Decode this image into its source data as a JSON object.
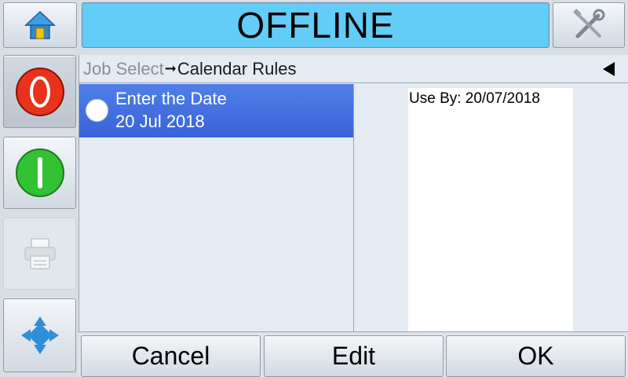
{
  "header": {
    "status": "OFFLINE",
    "home_icon": "home-icon",
    "tools_icon": "tools-icon"
  },
  "sidebar": {
    "stop_icon": "stop-icon",
    "start_icon": "start-icon",
    "print_icon": "printer-icon",
    "nav_icon": "navigation-arrows-icon"
  },
  "breadcrumb": {
    "parent": "Job Select",
    "arrow": "➞",
    "current": "Calendar Rules"
  },
  "rules": [
    {
      "title": "Enter the Date",
      "value": "20 Jul 2018"
    }
  ],
  "preview": {
    "text": "Use By: 20/07/2018"
  },
  "actions": {
    "cancel": "Cancel",
    "edit": "Edit",
    "ok": "OK"
  },
  "colors": {
    "status_bg": "#63ccf7",
    "selected_row": "#3f6ddd",
    "stop_red": "#e8321c",
    "start_green": "#33c233"
  }
}
